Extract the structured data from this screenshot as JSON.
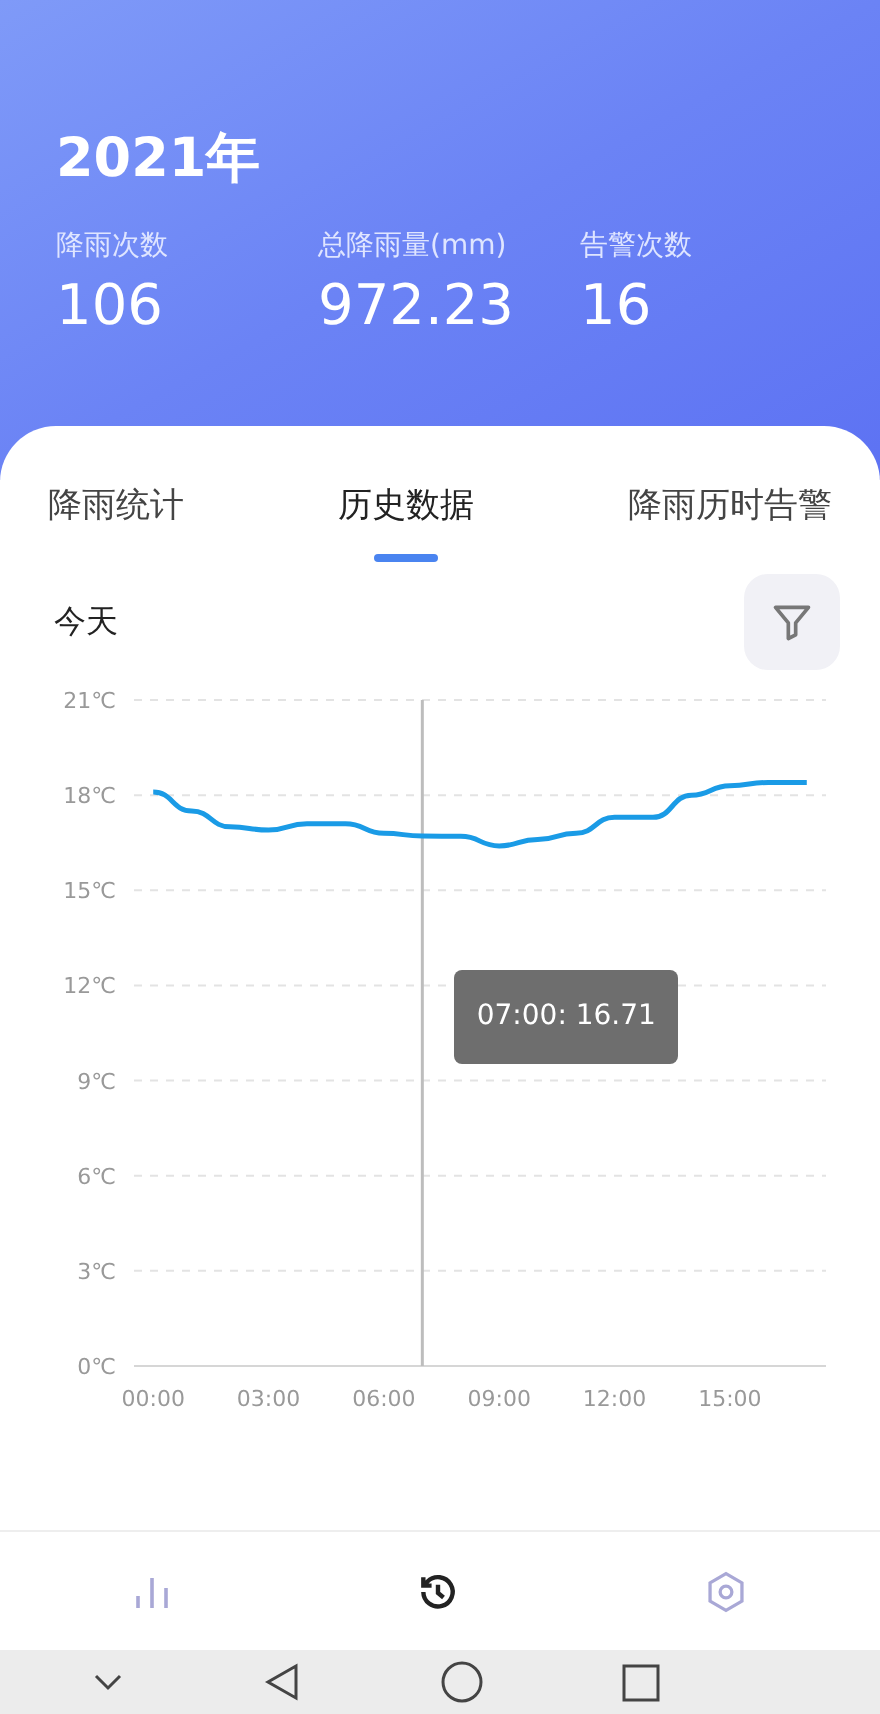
{
  "header": {
    "title": "2021年",
    "stats": [
      {
        "label": "降雨次数",
        "value": "106"
      },
      {
        "label": "总降雨量(mm)",
        "value": "972.23"
      },
      {
        "label": "告警次数",
        "value": "16"
      }
    ]
  },
  "tabs": [
    {
      "label": "降雨统计",
      "selected": false
    },
    {
      "label": "历史数据",
      "selected": true
    },
    {
      "label": "降雨历时告警",
      "selected": false
    }
  ],
  "filter": {
    "label": "今天"
  },
  "chart_data": {
    "type": "line",
    "x": [
      0,
      1,
      2,
      3,
      4,
      5,
      6,
      7,
      8,
      9,
      10,
      11,
      12,
      13,
      14,
      15,
      16,
      17
    ],
    "grid": true,
    "xlim": [
      -0.5,
      17.5
    ],
    "ref_lines": [
      {
        "axis": "x",
        "value": 7
      }
    ],
    "series": [
      {
        "color": "#1a9be6",
        "values": [
          18.1,
          17.5,
          17.0,
          16.9,
          17.1,
          17.1,
          16.8,
          16.71,
          16.7,
          16.4,
          16.6,
          16.8,
          17.3,
          17.3,
          18.0,
          18.3,
          18.4,
          18.4
        ]
      }
    ],
    "ylim": [
      0,
      21
    ],
    "yticks": [
      {
        "value": 0,
        "label": "0℃"
      },
      {
        "value": 3,
        "label": "3℃"
      },
      {
        "value": 6,
        "label": "6℃"
      },
      {
        "value": 9,
        "label": "9℃"
      },
      {
        "value": 12,
        "label": "12℃"
      },
      {
        "value": 15,
        "label": "15℃"
      },
      {
        "value": 18,
        "label": "18℃"
      },
      {
        "value": 21,
        "label": "21℃"
      }
    ],
    "xticks": [
      {
        "value": 0,
        "label": "00:00"
      },
      {
        "value": 3,
        "label": "03:00"
      },
      {
        "value": 6,
        "label": "06:00"
      },
      {
        "value": 9,
        "label": "09:00"
      },
      {
        "value": 12,
        "label": "12:00"
      },
      {
        "value": 15,
        "label": "15:00"
      }
    ],
    "annotations": [
      "07:00: 16.71"
    ]
  },
  "bottom_nav": [
    {
      "kind": "stats",
      "selected": false
    },
    {
      "kind": "history",
      "selected": true
    },
    {
      "kind": "settings",
      "selected": false
    }
  ]
}
